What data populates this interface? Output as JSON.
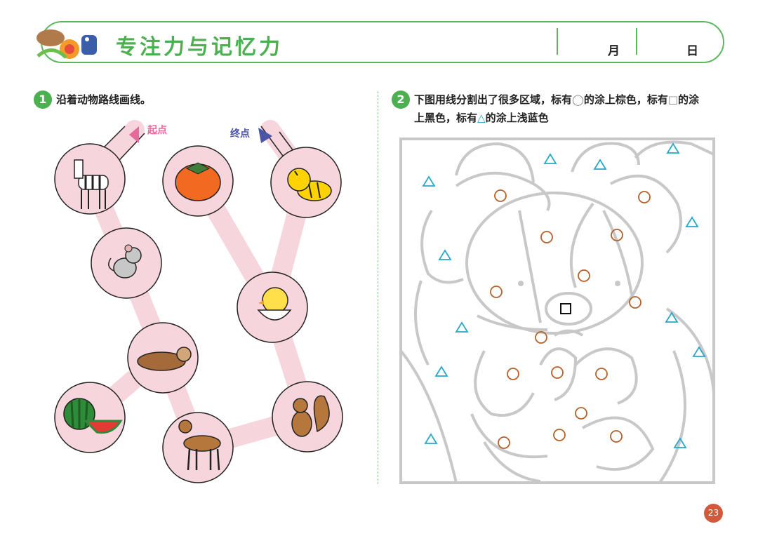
{
  "header": {
    "title": "专注力与记忆力",
    "month_label": "月",
    "day_label": "日"
  },
  "q1": {
    "number": "1",
    "text": "沿着动物路线画线。",
    "start_label": "起点",
    "end_label": "终点",
    "icons": [
      "zebra-icon",
      "mouse-icon",
      "sea-otter-icon",
      "watermelon-icon",
      "deer-icon",
      "persimmon-icon",
      "tiger-icon",
      "chick-icon",
      "squirrel-icon"
    ]
  },
  "q2": {
    "number": "2",
    "line1_a": "下图用线分割出了很多区域，标有",
    "circle_sym": "◯",
    "line1_b": "的涂上棕色，标有",
    "square_sym": "□",
    "line1_c": "的涂",
    "line2_a": "上黑色，标有",
    "triangle_sym": "△",
    "line2_b": "的涂上浅蓝色",
    "colors": {
      "circle": "#b5602b",
      "triangle": "#29a8c8",
      "square": "#111111",
      "outline": "#c8c8c8"
    }
  },
  "page_number": "23"
}
